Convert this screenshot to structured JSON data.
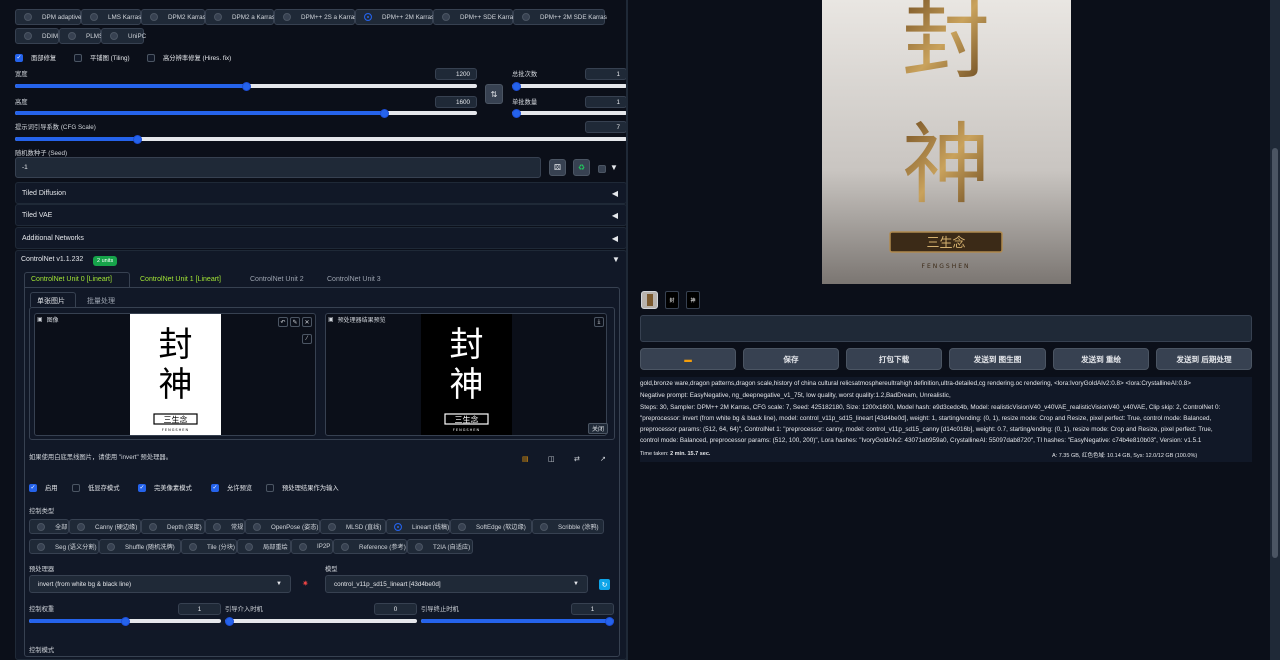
{
  "samplers": {
    "row1": [
      "DPM adaptive",
      "LMS Karras",
      "DPM2 Karras",
      "DPM2 a Karras",
      "DPM++ 2S a Karras",
      "DPM++ 2M Karras",
      "DPM++ SDE Karras",
      "DPM++ 2M SDE Karras"
    ],
    "row2": [
      "DDIM",
      "PLMS",
      "UniPC"
    ],
    "selected": "DPM++ 2M Karras"
  },
  "options": {
    "face_restore": "面部修复",
    "tiling": "平铺图 (Tiling)",
    "hires_fix": "高分辨率修复 (Hires. fix)"
  },
  "params": {
    "width_label": "宽度",
    "width": "1200",
    "width_frac": 0.5,
    "height_label": "高度",
    "height": "1600",
    "height_frac": 0.8,
    "batch_count_label": "总批次数",
    "batch_count": "1",
    "batch_count_frac": 0.0,
    "batch_size_label": "单批数量",
    "batch_size": "1",
    "batch_size_frac": 0.0,
    "swap_icon": "swap-dimensions-icon",
    "cfg_label": "提示词引导系数 (CFG Scale)",
    "cfg": "7",
    "cfg_frac": 0.2,
    "seed_label": "随机数种子 (Seed)",
    "seed": "-1"
  },
  "accordions": [
    "Tiled Diffusion",
    "Tiled VAE",
    "Additional Networks"
  ],
  "controlnet": {
    "title": "ControlNet v1.1.232",
    "badge": "2 units",
    "units": [
      "ControlNet Unit 0 [Lineart]",
      "ControlNet Unit 1 [Lineart]",
      "ControlNet Unit 2",
      "ControlNet Unit 3"
    ],
    "subtabs": [
      "单张图片",
      "批量处理"
    ],
    "image_label": "图像",
    "preview_label": "预处理器结果预览",
    "close_label": "关闭",
    "hint": "如果使用白底黑线图片，请使用 \"invert\" 预处理器。",
    "enable": "启用",
    "lowvram": "低显存模式",
    "pixel_perfect": "完美像素模式",
    "allow_preview": "允许预览",
    "preview_as_input": "预处理结果作为输入",
    "control_type_label": "控制类型",
    "types_row1": [
      "全部",
      "Canny (硬边缘)",
      "Depth (深度)",
      "常规",
      "OpenPose (姿态)",
      "MLSD (直线)",
      "Lineart (线稿)",
      "SoftEdge (软边缘)",
      "Scribble (涂鸦)"
    ],
    "types_row2": [
      "Seg (语义分割)",
      "Shuffle (随机洗牌)",
      "Tile (分块)",
      "局部重绘",
      "IP2P",
      "Reference (参考)",
      "T2IA (自适应)"
    ],
    "selected_type": "Lineart (线稿)",
    "preprocessor_label": "预处理器",
    "preprocessor": "invert (from white bg & black line)",
    "model_label": "模型",
    "model": "control_v11p_sd15_lineart [43d4be0d]",
    "weight_label": "控制权重",
    "weight": "1",
    "weight_frac": 0.5,
    "start_label": "引导介入时机",
    "start": "0",
    "start_frac": 0.0,
    "end_label": "引导终止时机",
    "end": "1",
    "end_frac": 1.0,
    "mode_label": "控制模式"
  },
  "artwork": {
    "char1": "封",
    "char2": "神",
    "small": "三生念",
    "latin": "FENGSHEN"
  },
  "actions": [
    "保存",
    "打包下载",
    "发送到 图生图",
    "发送到 重绘",
    "发送到 后期处理"
  ],
  "gen_info": {
    "line1": "gold,bronze ware,dragon patterns,dragon scale,history of china cultural relicsatmosphereultrahigh definition,ultra-detailed,cg rendering.oc rendering, <lora:IvoryGoldAIv2:0.8> <lora:CrystallineAI:0.8>",
    "line2": "Negative prompt: EasyNegative, ng_deepnegative_v1_75t, low quality, worst quality:1.2,BadDream, Unrealistic,",
    "line3": "Steps: 30, Sampler: DPM++ 2M Karras, CFG scale: 7, Seed: 425182180, Size: 1200x1600, Model hash: e9d3cedc4b, Model: realisticVisionV40_v40VAE_realisticVisionV40_v40VAE, Clip skip: 2, ControlNet 0:",
    "line4": "\"preprocessor: invert (from white bg & black line), model: control_v11p_sd15_lineart [43d4be0d], weight: 1, starting/ending: (0, 1), resize mode: Crop and Resize, pixel perfect: True, control mode: Balanced,",
    "line5": "preprocessor params: (512, 64, 64)\", ControlNet 1: \"preprocessor: canny, model: control_v11p_sd15_canny [d14c016b], weight: 0.7, starting/ending: (0, 1), resize mode: Crop and Resize, pixel perfect: True,",
    "line6": "control mode: Balanced, preprocessor params: (512, 100, 200)\", Lora hashes: \"IvoryGoldAIv2: 43071eb959a0, CrystallineAI: 55097dab8720\", TI hashes: \"EasyNegative: c74b4e810b03\", Version: v1.5.1",
    "time_label": "Time taken:",
    "time": "2 min. 15.7 sec.",
    "vram": "A: 7.35 GB, 红色色域: 10.14 GB, Sys: 12.0/12 GB (100.0%)"
  }
}
